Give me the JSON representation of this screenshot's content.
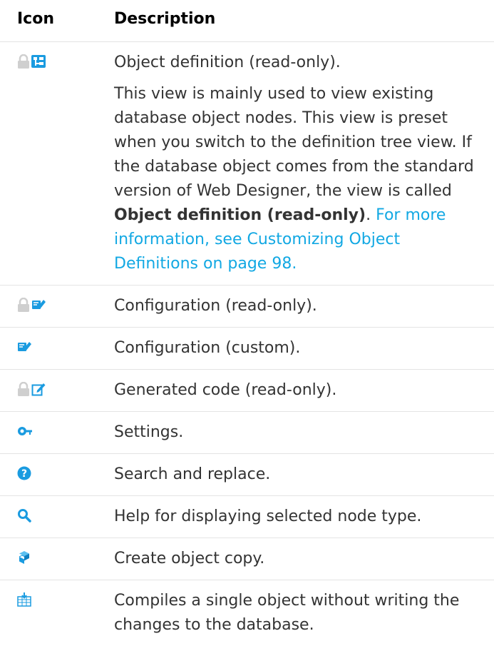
{
  "headers": {
    "icon": "Icon",
    "description": "Description"
  },
  "colors": {
    "link": "#12a8e3",
    "icon_blue": "#1a9be0",
    "lock_gray": "#c8c8c8"
  },
  "rows": [
    {
      "icon": "lock-and-tree-icon",
      "title": "Object definition (read-only).",
      "body_text": "This view is mainly used to view existing database object nodes. This view is preset when you switch to the definition tree view. If the database object comes from the standard version of Web Designer, the view is called ",
      "body_bold": "Object definition (read-only)",
      "body_after_bold": ". ",
      "body_link": "For more information, see Customizing Object Definitions on page 98."
    },
    {
      "icon": "lock-and-config-icon",
      "title": "Configuration (read-only)."
    },
    {
      "icon": "config-icon",
      "title": "Configuration (custom)."
    },
    {
      "icon": "lock-and-edit-icon",
      "title": "Generated code (read-only)."
    },
    {
      "icon": "settings-key-icon",
      "title": "Settings."
    },
    {
      "icon": "help-question-icon",
      "title": "Search and replace."
    },
    {
      "icon": "search-magnifier-icon",
      "title": "Help for displaying selected node type."
    },
    {
      "icon": "object-copy-icon",
      "title": "Create object copy."
    },
    {
      "icon": "compile-icon",
      "title": "Compiles a single object without writing the changes to the database."
    }
  ]
}
